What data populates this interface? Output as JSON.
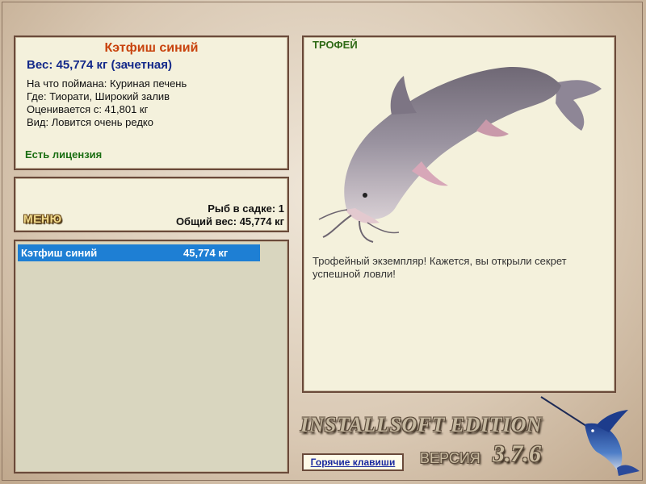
{
  "info": {
    "fish_name": "Кэтфиш синий",
    "weight": "Вес: 45,774 кг (зачетная)",
    "bait": "На что поймана: Куриная печень",
    "location": "Где: Тиорати, Широкий залив",
    "valued_from": "Оценивается с: 41,801 кг",
    "species_note": "Вид: Ловится очень редко",
    "license": "Есть лицензия"
  },
  "menu": {
    "label": "МЕНЮ",
    "fish_in_keepnet": "Рыб в садке: 1",
    "total_weight": "Общий вес: 45,774 кг"
  },
  "catch_list": [
    {
      "name": "Кэтфиш синий",
      "weight": "45,774 кг"
    }
  ],
  "trophy": {
    "title": "ТРОФЕЙ",
    "description": "Трофейный экземпляр! Кажется, вы открыли секрет успешной ловли!"
  },
  "footer": {
    "edition": "INSTALLSOFT EDITION",
    "version_label": "ВЕРСИЯ",
    "version_number": "3.7.6",
    "hotkeys_label": "Горячие клавиши"
  },
  "colors": {
    "fish_name": "#c8420c",
    "weight": "#142a8a",
    "license": "#1a6e12",
    "selected_row": "#1e7fd4",
    "panel_bg": "#f4f1dc"
  }
}
